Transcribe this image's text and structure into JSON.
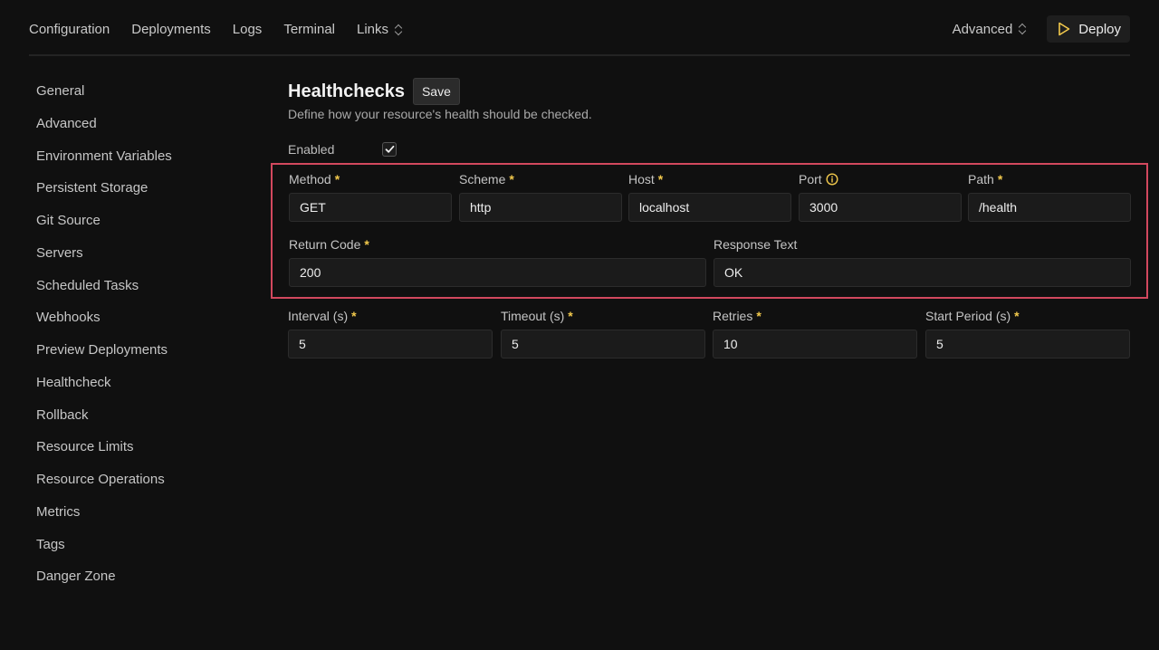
{
  "topnav": {
    "items": [
      {
        "label": "Configuration"
      },
      {
        "label": "Deployments"
      },
      {
        "label": "Logs"
      },
      {
        "label": "Terminal"
      },
      {
        "label": "Links"
      }
    ],
    "advanced_label": "Advanced",
    "deploy_label": "Deploy",
    "deploy_icon_color": "#f2c94c"
  },
  "sidebar": {
    "items": [
      {
        "label": "General"
      },
      {
        "label": "Advanced"
      },
      {
        "label": "Environment Variables"
      },
      {
        "label": "Persistent Storage"
      },
      {
        "label": "Git Source"
      },
      {
        "label": "Servers"
      },
      {
        "label": "Scheduled Tasks"
      },
      {
        "label": "Webhooks"
      },
      {
        "label": "Preview Deployments"
      },
      {
        "label": "Healthcheck"
      },
      {
        "label": "Rollback"
      },
      {
        "label": "Resource Limits"
      },
      {
        "label": "Resource Operations"
      },
      {
        "label": "Metrics"
      },
      {
        "label": "Tags"
      },
      {
        "label": "Danger Zone"
      }
    ]
  },
  "main": {
    "title": "Healthchecks",
    "save_label": "Save",
    "subtitle": "Define how your resource's health should be checked.",
    "enabled_label": "Enabled",
    "enabled": true,
    "fields": {
      "method": {
        "label": "Method",
        "value": "GET",
        "required": "*"
      },
      "scheme": {
        "label": "Scheme",
        "value": "http",
        "required": "*"
      },
      "host": {
        "label": "Host",
        "value": "localhost",
        "required": "*"
      },
      "port": {
        "label": "Port",
        "value": "3000"
      },
      "path": {
        "label": "Path",
        "value": "/health",
        "required": "*"
      },
      "return_code": {
        "label": "Return Code",
        "value": "200",
        "required": "*"
      },
      "response_text": {
        "label": "Response Text",
        "value": "OK"
      },
      "interval": {
        "label": "Interval (s)",
        "value": "5",
        "required": "*"
      },
      "timeout": {
        "label": "Timeout (s)",
        "value": "5",
        "required": "*"
      },
      "retries": {
        "label": "Retries",
        "value": "10",
        "required": "*"
      },
      "start_period": {
        "label": "Start Period (s)",
        "value": "5",
        "required": "*"
      }
    },
    "highlight_color": "#d2485e",
    "required_color": "#f2c94c"
  }
}
